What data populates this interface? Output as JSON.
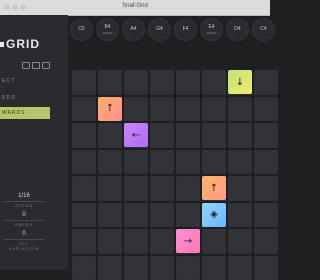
{
  "window": {
    "title": "Snaf-Grid"
  },
  "sidebar": {
    "logo": "GRID",
    "menu": [
      {
        "label": "ECT",
        "active": false
      },
      {
        "label": "RDS",
        "active": false
      },
      {
        "label": "WARDS",
        "active": true
      }
    ],
    "marker": ".",
    "params": [
      {
        "value": "1/16",
        "label": "SPEED"
      },
      {
        "value": "0",
        "label": "SWING"
      },
      {
        "value": "0",
        "label": "VEL VARIATION"
      }
    ]
  },
  "notes": [
    {
      "name": "C5",
      "sub": ""
    },
    {
      "name": "B4",
      "sub": "SHUFF"
    },
    {
      "name": "A4",
      "sub": ""
    },
    {
      "name": "G4",
      "sub": ""
    },
    {
      "name": "F4",
      "sub": ""
    },
    {
      "name": "E4",
      "sub": "SHUFF"
    },
    {
      "name": "D4",
      "sub": ""
    },
    {
      "name": "C4",
      "sub": ""
    }
  ],
  "grid": {
    "cols": 8,
    "rows": 8,
    "arrows": [
      {
        "row": 0,
        "col": 6,
        "glyph": "↓",
        "color": "#b9e67a",
        "color2": "#f7e96b",
        "icon": "arrow-down-icon"
      },
      {
        "row": 1,
        "col": 1,
        "glyph": "↑",
        "color": "#ffb16b",
        "color2": "#ff8e8e",
        "icon": "arrow-up-icon"
      },
      {
        "row": 2,
        "col": 2,
        "glyph": "←",
        "color": "#c985ff",
        "color2": "#b16cf0",
        "icon": "arrow-left-icon"
      },
      {
        "row": 4,
        "col": 5,
        "glyph": "↑",
        "color": "#ffb16b",
        "color2": "#ff9b8a",
        "icon": "arrow-up-icon"
      },
      {
        "row": 5,
        "col": 5,
        "glyph": "◈",
        "color": "#8ad8ff",
        "color2": "#6fb4ff",
        "icon": "diamond-icon"
      },
      {
        "row": 6,
        "col": 4,
        "glyph": "→",
        "color": "#ff8fd2",
        "color2": "#ff77b8",
        "icon": "arrow-right-icon"
      }
    ]
  }
}
